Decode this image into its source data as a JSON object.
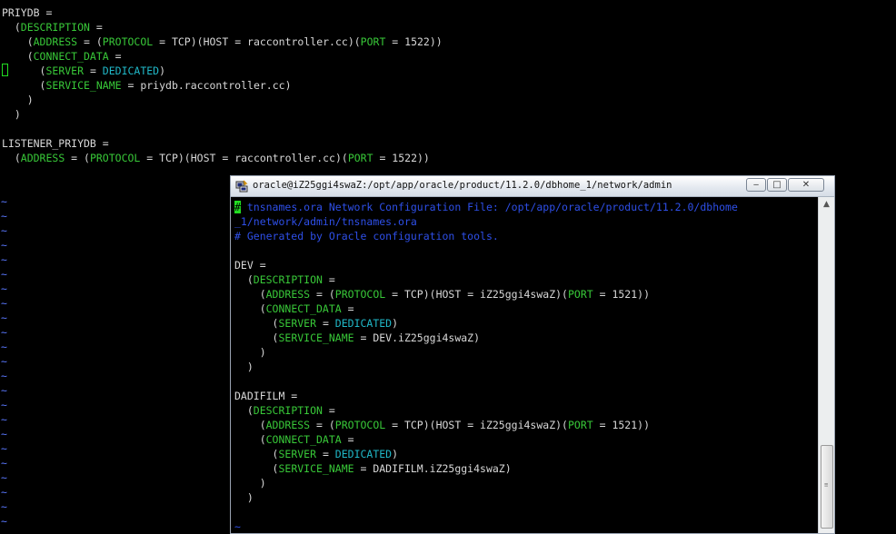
{
  "background": {
    "lines": [
      {
        "parts": [
          {
            "t": "PRIYDB =",
            "c": ""
          }
        ]
      },
      {
        "parts": [
          {
            "t": "  (",
            "c": ""
          },
          {
            "t": "DESCRIPTION",
            "c": "kw"
          },
          {
            "t": " =",
            "c": ""
          }
        ]
      },
      {
        "parts": [
          {
            "t": "    (",
            "c": ""
          },
          {
            "t": "ADDRESS",
            "c": "kw"
          },
          {
            "t": " = (",
            "c": ""
          },
          {
            "t": "PROTOCOL",
            "c": "kw"
          },
          {
            "t": " = TCP)(HOST = raccontroller.cc)(",
            "c": ""
          },
          {
            "t": "PORT",
            "c": "kw"
          },
          {
            "t": " = 1522))",
            "c": ""
          }
        ]
      },
      {
        "parts": [
          {
            "t": "    (",
            "c": ""
          },
          {
            "t": "CONNECT_DATA",
            "c": "kw"
          },
          {
            "t": " =",
            "c": ""
          }
        ]
      },
      {
        "parts": [
          {
            "t": "      (",
            "c": ""
          },
          {
            "t": "SERVER",
            "c": "kw"
          },
          {
            "t": " = ",
            "c": ""
          },
          {
            "t": "DEDICATED",
            "c": "cyan"
          },
          {
            "t": ")",
            "c": ""
          }
        ]
      },
      {
        "parts": [
          {
            "t": "      (",
            "c": ""
          },
          {
            "t": "SERVICE_NAME",
            "c": "kw"
          },
          {
            "t": " = priydb.raccontroller.cc)",
            "c": ""
          }
        ]
      },
      {
        "parts": [
          {
            "t": "    )",
            "c": ""
          }
        ]
      },
      {
        "parts": [
          {
            "t": "  )",
            "c": ""
          }
        ]
      },
      {
        "parts": [
          {
            "t": "",
            "c": ""
          }
        ]
      },
      {
        "parts": [
          {
            "t": "LISTENER_PRIYDB =",
            "c": ""
          }
        ]
      },
      {
        "parts": [
          {
            "t": "  (",
            "c": ""
          },
          {
            "t": "ADDRESS",
            "c": "kw"
          },
          {
            "t": " = (",
            "c": ""
          },
          {
            "t": "PROTOCOL",
            "c": "kw"
          },
          {
            "t": " = TCP)(HOST = raccontroller.cc)(",
            "c": ""
          },
          {
            "t": "PORT",
            "c": "kw"
          },
          {
            "t": " = 1522))",
            "c": ""
          }
        ]
      }
    ],
    "tilde_char": "~",
    "tilde_count": 23
  },
  "window": {
    "title": "oracle@iZ25ggi4swaZ:/opt/app/oracle/product/11.2.0/dbhome_1/network/admin",
    "min_label": "‒",
    "max_label": "□",
    "close_label": "✕",
    "lines": [
      {
        "parts": [
          {
            "t": "#",
            "c": "hash-cursor"
          },
          {
            "t": " tnsnames.ora Network Configuration File: /opt/app/oracle/product/11.2.0/dbhome",
            "c": "comment"
          }
        ]
      },
      {
        "parts": [
          {
            "t": "_1/network/admin/tnsnames.ora",
            "c": "comment"
          }
        ]
      },
      {
        "parts": [
          {
            "t": "# Generated by Oracle configuration tools.",
            "c": "comment"
          }
        ]
      },
      {
        "parts": [
          {
            "t": "",
            "c": ""
          }
        ]
      },
      {
        "parts": [
          {
            "t": "DEV =",
            "c": ""
          }
        ]
      },
      {
        "parts": [
          {
            "t": "  (",
            "c": ""
          },
          {
            "t": "DESCRIPTION",
            "c": "kw"
          },
          {
            "t": " =",
            "c": ""
          }
        ]
      },
      {
        "parts": [
          {
            "t": "    (",
            "c": ""
          },
          {
            "t": "ADDRESS",
            "c": "kw"
          },
          {
            "t": " = (",
            "c": ""
          },
          {
            "t": "PROTOCOL",
            "c": "kw"
          },
          {
            "t": " = TCP)(HOST = iZ25ggi4swaZ)(",
            "c": ""
          },
          {
            "t": "PORT",
            "c": "kw"
          },
          {
            "t": " = 1521))",
            "c": ""
          }
        ]
      },
      {
        "parts": [
          {
            "t": "    (",
            "c": ""
          },
          {
            "t": "CONNECT_DATA",
            "c": "kw"
          },
          {
            "t": " =",
            "c": ""
          }
        ]
      },
      {
        "parts": [
          {
            "t": "      (",
            "c": ""
          },
          {
            "t": "SERVER",
            "c": "kw"
          },
          {
            "t": " = ",
            "c": ""
          },
          {
            "t": "DEDICATED",
            "c": "cyan"
          },
          {
            "t": ")",
            "c": ""
          }
        ]
      },
      {
        "parts": [
          {
            "t": "      (",
            "c": ""
          },
          {
            "t": "SERVICE_NAME",
            "c": "kw"
          },
          {
            "t": " = DEV.iZ25ggi4swaZ)",
            "c": ""
          }
        ]
      },
      {
        "parts": [
          {
            "t": "    )",
            "c": ""
          }
        ]
      },
      {
        "parts": [
          {
            "t": "  )",
            "c": ""
          }
        ]
      },
      {
        "parts": [
          {
            "t": "",
            "c": ""
          }
        ]
      },
      {
        "parts": [
          {
            "t": "DADIFILM =",
            "c": ""
          }
        ]
      },
      {
        "parts": [
          {
            "t": "  (",
            "c": ""
          },
          {
            "t": "DESCRIPTION",
            "c": "kw"
          },
          {
            "t": " =",
            "c": ""
          }
        ]
      },
      {
        "parts": [
          {
            "t": "    (",
            "c": ""
          },
          {
            "t": "ADDRESS",
            "c": "kw"
          },
          {
            "t": " = (",
            "c": ""
          },
          {
            "t": "PROTOCOL",
            "c": "kw"
          },
          {
            "t": " = TCP)(HOST = iZ25ggi4swaZ)(",
            "c": ""
          },
          {
            "t": "PORT",
            "c": "kw"
          },
          {
            "t": " = 1521))",
            "c": ""
          }
        ]
      },
      {
        "parts": [
          {
            "t": "    (",
            "c": ""
          },
          {
            "t": "CONNECT_DATA",
            "c": "kw"
          },
          {
            "t": " =",
            "c": ""
          }
        ]
      },
      {
        "parts": [
          {
            "t": "      (",
            "c": ""
          },
          {
            "t": "SERVER",
            "c": "kw"
          },
          {
            "t": " = ",
            "c": ""
          },
          {
            "t": "DEDICATED",
            "c": "cyan"
          },
          {
            "t": ")",
            "c": ""
          }
        ]
      },
      {
        "parts": [
          {
            "t": "      (",
            "c": ""
          },
          {
            "t": "SERVICE_NAME",
            "c": "kw"
          },
          {
            "t": " = DADIFILM.iZ25ggi4swaZ)",
            "c": ""
          }
        ]
      },
      {
        "parts": [
          {
            "t": "    )",
            "c": ""
          }
        ]
      },
      {
        "parts": [
          {
            "t": "  )",
            "c": ""
          }
        ]
      },
      {
        "parts": [
          {
            "t": "",
            "c": ""
          }
        ]
      },
      {
        "parts": [
          {
            "t": "~",
            "c": "comment"
          }
        ]
      }
    ]
  },
  "colors": {
    "keyword": "#38c838",
    "value": "#20b8c8",
    "comment": "#2e4fe8",
    "tilde": "#5a78ff",
    "text": "#d8d8d8",
    "background": "#000000"
  }
}
